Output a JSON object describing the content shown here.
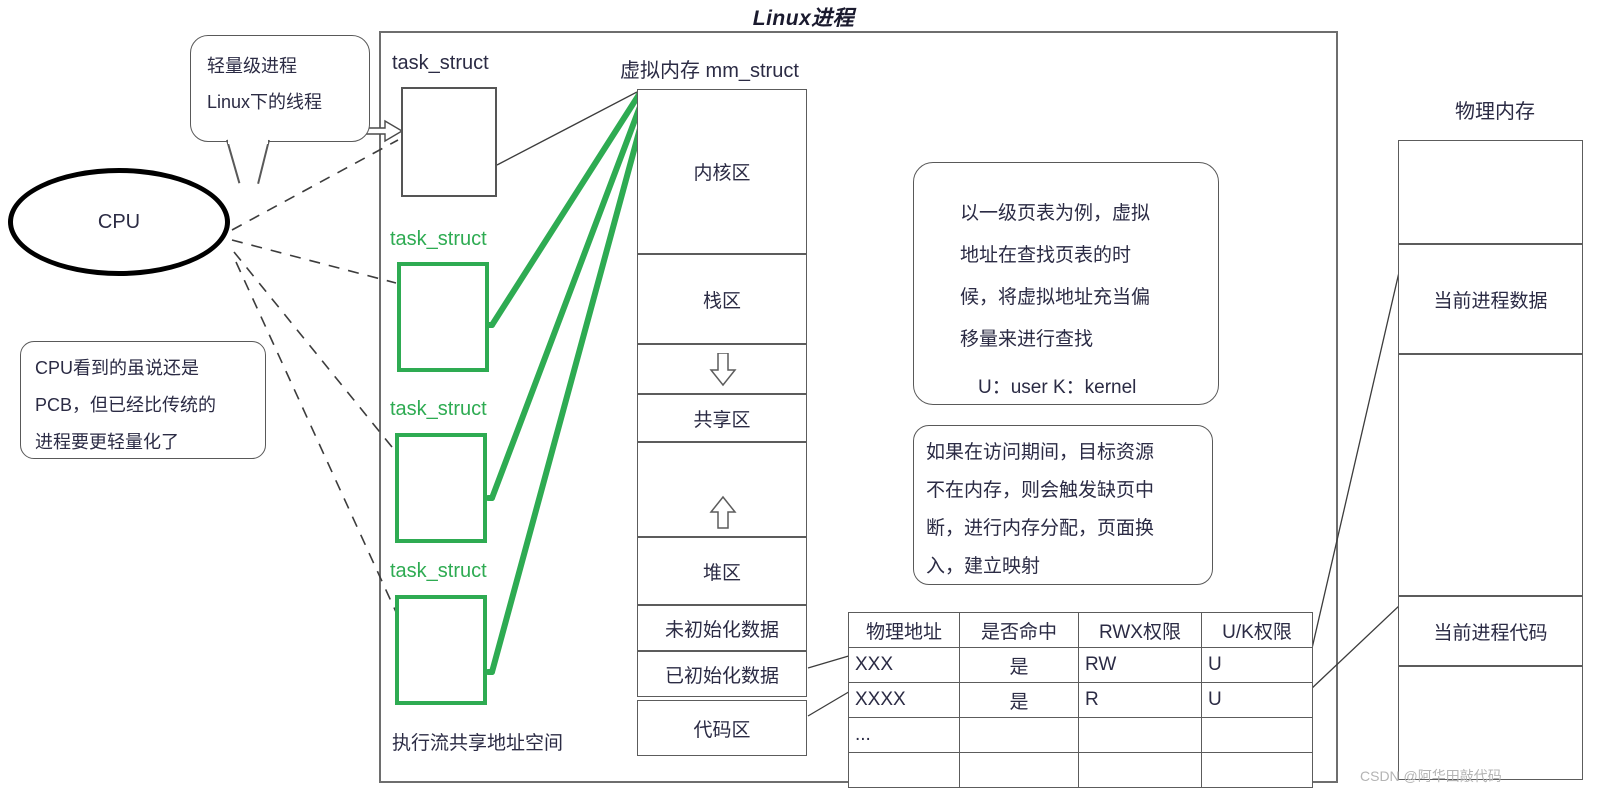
{
  "title": "Linux进程",
  "cpu": {
    "label": "CPU"
  },
  "callouts": {
    "thread": {
      "line1": "轻量级进程",
      "line2": "Linux下的线程"
    },
    "pcb": {
      "line1": "CPU看到的虽说还是",
      "line2": "PCB，但已经比传统的",
      "line3": "进程要更轻量化了"
    },
    "page_table_note": {
      "line1": "以一级页表为例，虚拟",
      "line2": "地址在查找页表的时",
      "line3": "候，将虚拟地址充当偏",
      "line4": "移量来进行查找",
      "legend": "U：user  K：kernel"
    },
    "page_fault_note": {
      "line1": "如果在访问期间，目标资源",
      "line2": "不在内存，则会触发缺页中",
      "line3": "断，进行内存分配，页面换",
      "line4": "入，建立映射"
    }
  },
  "task_structs": [
    {
      "label": "task_struct",
      "color": "grey"
    },
    {
      "label": "task_struct",
      "color": "green"
    },
    {
      "label": "task_struct",
      "color": "green"
    },
    {
      "label": "task_struct",
      "color": "green"
    }
  ],
  "exec_flow_label": "执行流共享地址空间",
  "virtual_memory": {
    "title": "虚拟内存 mm_struct",
    "cells": [
      {
        "label": "内核区"
      },
      {
        "label": "栈区"
      },
      {
        "label": "",
        "icon": "arrow-down-icon"
      },
      {
        "label": "共享区"
      },
      {
        "label": "",
        "icon": "arrow-up-icon"
      },
      {
        "label": "堆区"
      },
      {
        "label": "未初始化数据"
      },
      {
        "label": "已初始化数据"
      },
      {
        "label": "代码区"
      },
      {
        "label": ""
      }
    ]
  },
  "page_table": {
    "headers": [
      "物理地址",
      "是否命中",
      "RWX权限",
      "U/K权限"
    ],
    "rows": [
      [
        "XXX",
        "是",
        "RW",
        "U"
      ],
      [
        "XXXX",
        "是",
        "R",
        "U"
      ],
      [
        "...",
        "",
        "",
        ""
      ],
      [
        "",
        "",
        "",
        ""
      ]
    ]
  },
  "physical_memory": {
    "title": "物理内存",
    "cells": [
      {
        "label": ""
      },
      {
        "label": "当前进程数据"
      },
      {
        "label": ""
      },
      {
        "label": "当前进程代码"
      },
      {
        "label": ""
      }
    ]
  },
  "watermark": "CSDN @阿华田敲代码",
  "colors": {
    "green": "#2eab52",
    "grey_border": "#5c5c5c",
    "text": "#2b2b44",
    "black": "#000000"
  }
}
